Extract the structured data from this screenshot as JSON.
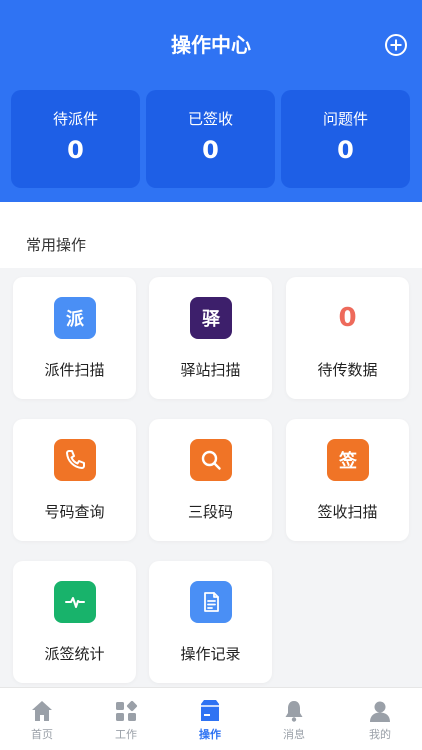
{
  "header": {
    "title": "操作中心",
    "add_icon": "plus-circle-icon"
  },
  "stats": [
    {
      "label": "待派件",
      "value": "0"
    },
    {
      "label": "已签收",
      "value": "0"
    },
    {
      "label": "问题件",
      "value": "0"
    }
  ],
  "section": {
    "title": "常用操作"
  },
  "cards": [
    {
      "label": "派件扫描",
      "icon_text": "派",
      "icon": "dispatch-scan-icon",
      "color": "#4a8ff5"
    },
    {
      "label": "驿站扫描",
      "icon_text": "驿",
      "icon": "station-scan-icon",
      "color": "#3d1f6b"
    },
    {
      "label": "待传数据",
      "value": "0",
      "value_color": "#ee6a5b"
    },
    {
      "label": "号码查询",
      "icon": "phone-icon",
      "color": "#f07426"
    },
    {
      "label": "三段码",
      "icon": "search-icon",
      "color": "#f07426"
    },
    {
      "label": "签收扫描",
      "icon_text": "签",
      "icon": "sign-scan-icon",
      "color": "#f07426"
    },
    {
      "label": "派签统计",
      "icon": "pulse-icon",
      "color": "#18b36b"
    },
    {
      "label": "操作记录",
      "icon": "document-icon",
      "color": "#4a8ff5"
    }
  ],
  "tabbar": [
    {
      "label": "首页",
      "icon": "home-icon"
    },
    {
      "label": "工作",
      "icon": "apps-icon"
    },
    {
      "label": "操作",
      "icon": "box-icon",
      "active": true
    },
    {
      "label": "消息",
      "icon": "bell-icon"
    },
    {
      "label": "我的",
      "icon": "user-icon"
    }
  ],
  "colors": {
    "primary": "#2f73f3",
    "stat_card": "#1e5fe6",
    "background": "#f3f4f6"
  }
}
